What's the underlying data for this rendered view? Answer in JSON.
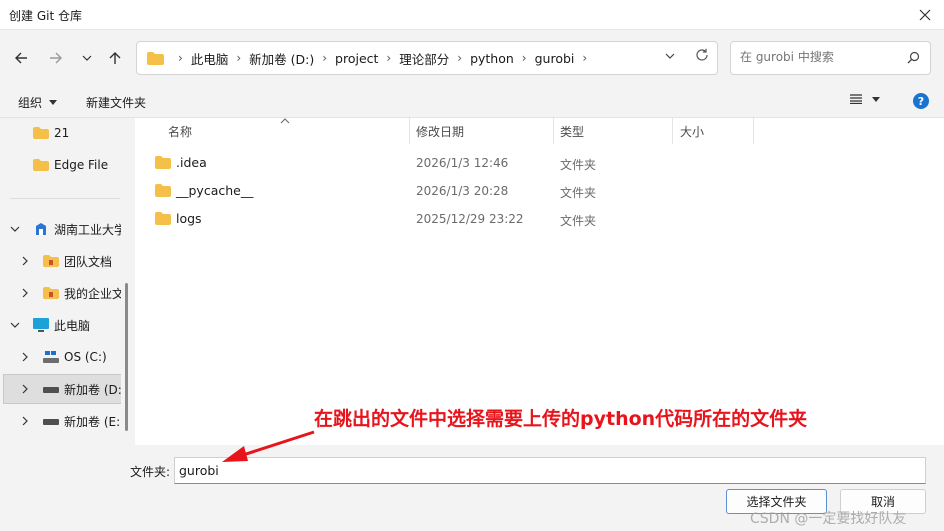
{
  "window": {
    "title": "创建 Git 仓库"
  },
  "address": {
    "segments": [
      "此电脑",
      "新加卷 (D:)",
      "project",
      "理论部分",
      "python",
      "gurobi"
    ]
  },
  "search": {
    "placeholder": "在 gurobi 中搜索"
  },
  "toolbar": {
    "organize": "组织",
    "new_folder": "新建文件夹",
    "help": "?"
  },
  "sidebar": {
    "items": [
      {
        "label": "21"
      },
      {
        "label": "Edge File"
      },
      {
        "label": "湖南工业大学"
      },
      {
        "label": "团队文档"
      },
      {
        "label": "我的企业文档"
      },
      {
        "label": "此电脑"
      },
      {
        "label": "OS (C:)"
      },
      {
        "label": "新加卷 (D:)"
      },
      {
        "label": "新加卷 (E:)"
      }
    ]
  },
  "columns": {
    "name": "名称",
    "date": "修改日期",
    "type": "类型",
    "size": "大小"
  },
  "files": [
    {
      "name": ".idea",
      "date": "2026/1/3 12:46",
      "type": "文件夹"
    },
    {
      "name": "__pycache__",
      "date": "2026/1/3 20:28",
      "type": "文件夹"
    },
    {
      "name": "logs",
      "date": "2025/12/29 23:22",
      "type": "文件夹"
    }
  ],
  "footer": {
    "folder_label": "文件夹:",
    "folder_value": "gurobi",
    "select_button": "选择文件夹",
    "cancel_button": "取消"
  },
  "annotation": {
    "text": "在跳出的文件中选择需要上传的python代码所在的文件夹"
  },
  "watermark": "CSDN @一定要找好队友",
  "colors": {
    "accent": "#1a73d0",
    "annotation": "#e8141c",
    "folder": "#f5c04a"
  }
}
